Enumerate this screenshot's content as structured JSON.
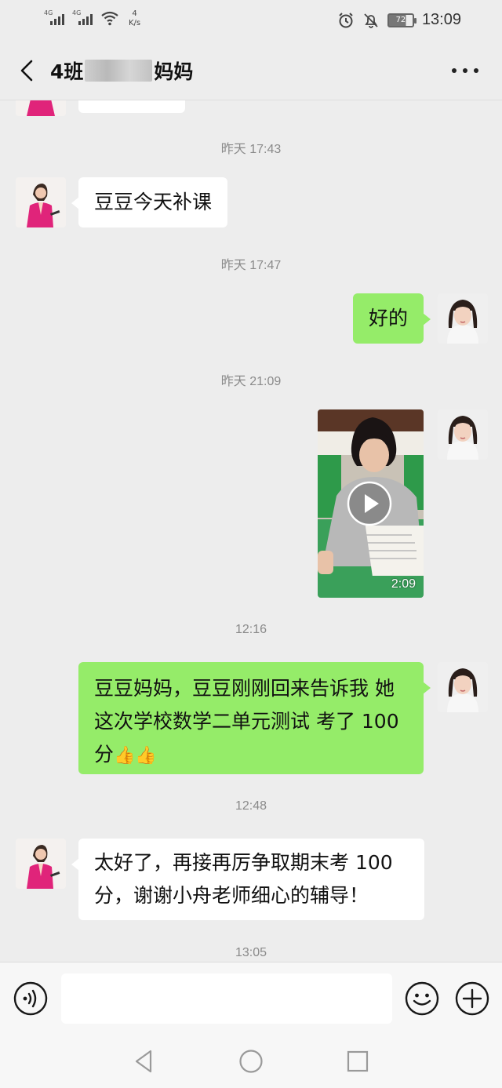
{
  "status_bar": {
    "signal_1_label": "4G",
    "signal_2_label": "4G",
    "net_speed_value": "4",
    "net_speed_unit": "K/s",
    "battery_level": "72",
    "time": "13:09",
    "icons": [
      "signal-icon",
      "signal-icon",
      "wifi-icon",
      "alarm-icon",
      "mute-icon",
      "battery-icon"
    ]
  },
  "header": {
    "title_prefix": "4班",
    "title_suffix": "妈妈",
    "icons": {
      "back": "chevron-left-icon",
      "more": "more-icon"
    }
  },
  "messages": [
    {
      "type": "timestamp",
      "text": "昨天 17:43"
    },
    {
      "type": "text",
      "direction": "incoming",
      "text": "豆豆今天补课"
    },
    {
      "type": "timestamp",
      "text": "昨天 17:47"
    },
    {
      "type": "text",
      "direction": "outgoing",
      "text": "好的"
    },
    {
      "type": "timestamp",
      "text": "昨天 21:09"
    },
    {
      "type": "video",
      "direction": "outgoing",
      "duration": "2:09"
    },
    {
      "type": "timestamp",
      "text": "12:16"
    },
    {
      "type": "text",
      "direction": "outgoing",
      "line1": "豆豆妈妈，豆豆刚刚回来告诉我 她",
      "line2": "这次学校数学二单元测试 考了 100",
      "line3": "分",
      "emoji": "👍👍"
    },
    {
      "type": "timestamp",
      "text": "12:48"
    },
    {
      "type": "text",
      "direction": "incoming",
      "line1": "太好了，再接再厉争取期末考 100",
      "line2": "分，谢谢小舟老师细心的辅导！"
    },
    {
      "type": "timestamp",
      "text": "13:05"
    }
  ],
  "input_bar": {
    "value": "",
    "icons": {
      "voice": "voice-icon",
      "emoji": "emoji-icon",
      "plus": "plus-icon"
    }
  },
  "system_nav": {
    "icons": [
      "back-triangle-icon",
      "home-circle-icon",
      "recents-square-icon"
    ]
  },
  "colors": {
    "background": "#ededed",
    "outgoing_bubble": "#95ec69",
    "incoming_bubble": "#ffffff",
    "timestamp_text": "#8a8a8a"
  }
}
